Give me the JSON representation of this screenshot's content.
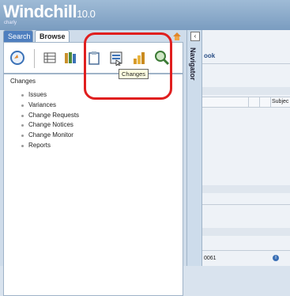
{
  "app": {
    "title": "Windchill",
    "version": "10.0",
    "user": "charly"
  },
  "tabs": [
    {
      "label": "Search"
    },
    {
      "label": "Browse"
    }
  ],
  "toolbar_tooltip": "Changes",
  "panel": {
    "title": "Changes",
    "items": [
      "Issues",
      "Variances",
      "Change Requests",
      "Change Notices",
      "Change Monitor",
      "Reports"
    ]
  },
  "navigator_label": "Navigator",
  "right": {
    "partial_title": "ook",
    "col_header": "Subjec",
    "partial_number": "0061"
  },
  "colors": {
    "accent_red": "#e01f1f",
    "tab_blue": "#4f7fbf"
  },
  "icons": [
    "home-icon",
    "recent-icon",
    "list-icon",
    "library-icon",
    "clipboard-icon",
    "changes-icon",
    "reports-chart-icon",
    "search-zoom-icon",
    "info-icon"
  ]
}
